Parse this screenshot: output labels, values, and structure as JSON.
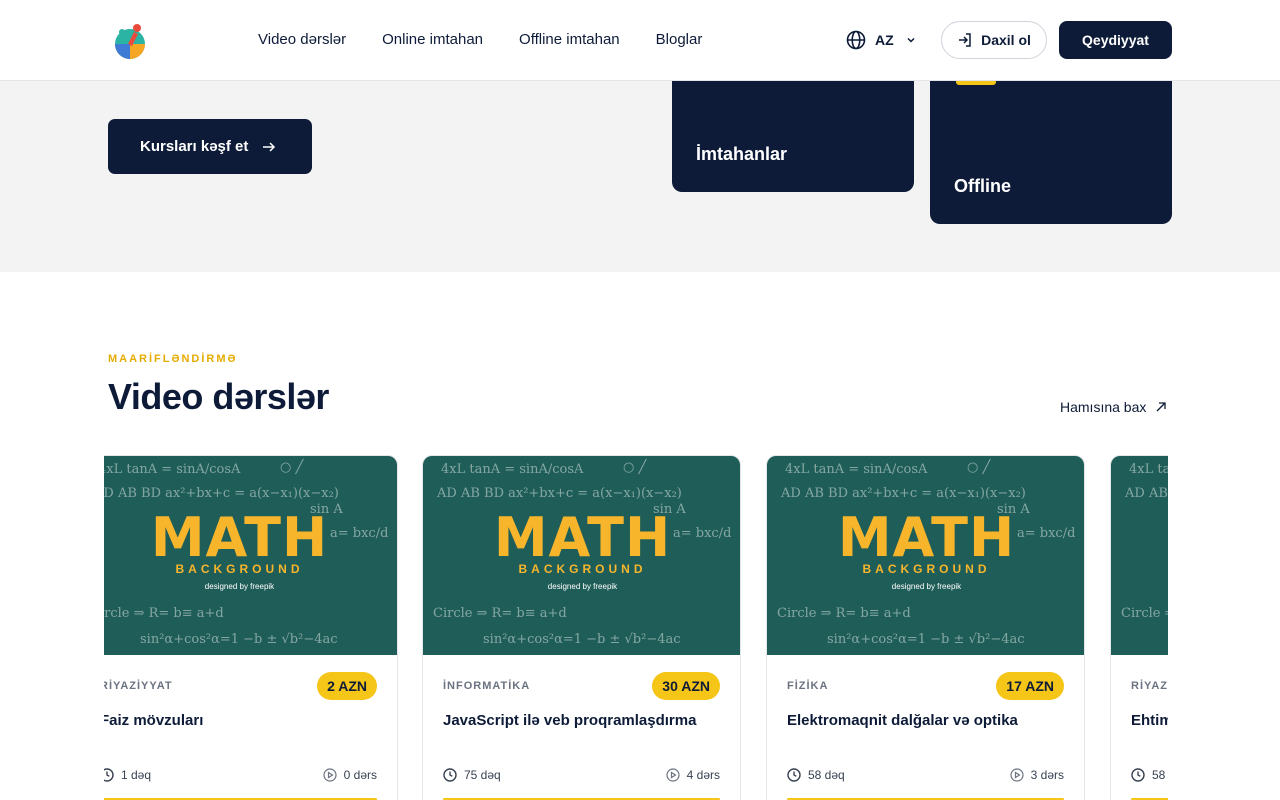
{
  "nav": {
    "items": [
      "Video dərslər",
      "Online imtahan",
      "Offline imtahan",
      "Bloglar"
    ],
    "lang": "AZ",
    "login": "Daxil ol",
    "register": "Qeydiyyat"
  },
  "hero": {
    "explore": "Kursları kəşf et",
    "card_exams": "İmtahanlar",
    "card_offline": "Offline"
  },
  "section": {
    "eyebrow": "MAARİFLƏNDİRMƏ",
    "title": "Video dərslər",
    "see_all": "Hamısına bax"
  },
  "thumbnail": {
    "headline": "MATH",
    "sub": "BACKGROUND",
    "credit": "designed by freepik"
  },
  "courses": [
    {
      "category": "RİYAZİYYAT",
      "price": "2 AZN",
      "title": "Faiz mövzuları",
      "duration": "1 dəq",
      "lessons": "0 dərs"
    },
    {
      "category": "İNFORMATİKA",
      "price": "30 AZN",
      "title": "JavaScript ilə veb proqramlaşdırma",
      "duration": "75 dəq",
      "lessons": "4 dərs"
    },
    {
      "category": "FİZİKA",
      "price": "17 AZN",
      "title": "Elektromaqnit dalğalar və optika",
      "duration": "58 dəq",
      "lessons": "3 dərs"
    },
    {
      "category": "RİYAZİYYAT",
      "price": "",
      "title": "Ehtimal",
      "duration": "58",
      "lessons": ""
    }
  ]
}
